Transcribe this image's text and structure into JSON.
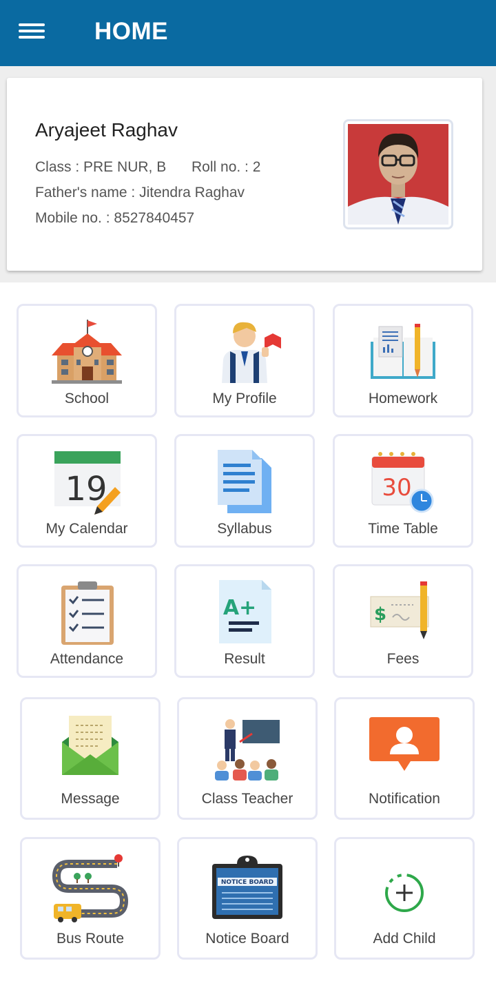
{
  "header": {
    "title": "HOME",
    "menu_icon": "hamburger-menu-icon"
  },
  "student": {
    "name": "Aryajeet Raghav",
    "class_text": "Class : PRE NUR, B",
    "roll_text": "Roll no. : 2",
    "father_text": "Father's name : Jitendra Raghav",
    "mobile_text": "Mobile no. : 8527840457"
  },
  "tiles": [
    {
      "label": "School",
      "icon": "school-icon"
    },
    {
      "label": "My Profile",
      "icon": "profile-icon"
    },
    {
      "label": "Homework",
      "icon": "homework-icon"
    },
    {
      "label": "My Calendar",
      "icon": "calendar-icon",
      "date": "19"
    },
    {
      "label": "Syllabus",
      "icon": "syllabus-icon"
    },
    {
      "label": "Time Table",
      "icon": "timetable-icon",
      "date": "30"
    },
    {
      "label": "Attendance",
      "icon": "attendance-icon"
    },
    {
      "label": "Result",
      "icon": "result-icon",
      "grade": "A+"
    },
    {
      "label": "Fees",
      "icon": "fees-icon",
      "symbol": "$"
    },
    {
      "label": "Message",
      "icon": "message-icon"
    },
    {
      "label": "Class Teacher",
      "icon": "class-teacher-icon"
    },
    {
      "label": "Notification",
      "icon": "notification-icon"
    },
    {
      "label": "Bus Route",
      "icon": "bus-route-icon"
    },
    {
      "label": "Notice Board",
      "icon": "notice-board-icon",
      "board_text": "NOTICE BOARD"
    },
    {
      "label": "Add Child",
      "icon": "add-child-icon"
    }
  ],
  "colors": {
    "appbar": "#0a6aa1",
    "tile_border": "#e6e7f4",
    "background_band": "#eeeeee"
  }
}
